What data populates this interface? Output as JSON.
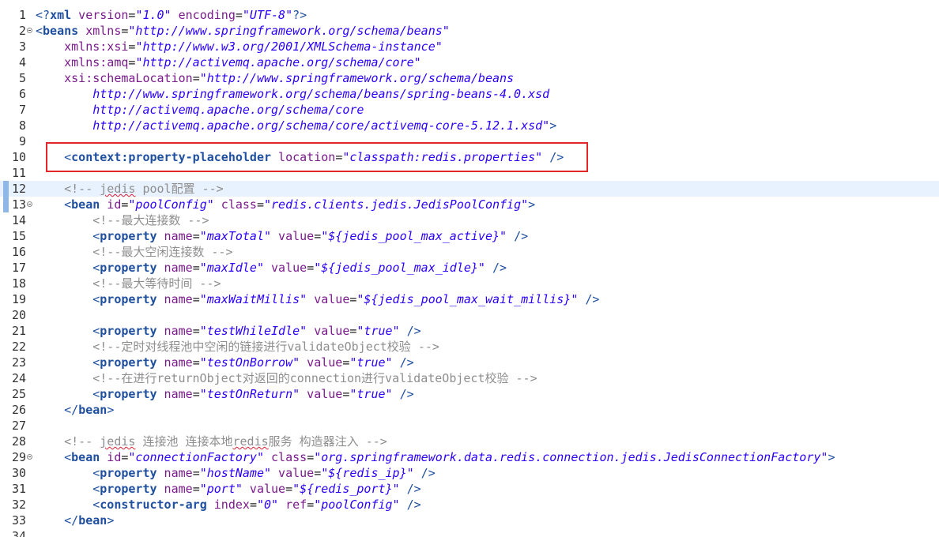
{
  "editor": {
    "lines": [
      {
        "n": "1",
        "segs": [
          {
            "c": "tag",
            "t": "<?"
          },
          {
            "c": "tagn",
            "t": "xml"
          },
          {
            "c": "an",
            "t": " version"
          },
          {
            "c": "pl",
            "t": "="
          },
          {
            "c": "av",
            "t": "\"1.0\""
          },
          {
            "c": "an",
            "t": " encoding"
          },
          {
            "c": "pl",
            "t": "="
          },
          {
            "c": "av",
            "t": "\"UTF-8\""
          },
          {
            "c": "tag",
            "t": "?>"
          }
        ]
      },
      {
        "n": "2",
        "fold": true,
        "segs": [
          {
            "c": "tag",
            "t": "<"
          },
          {
            "c": "tagn",
            "t": "beans"
          },
          {
            "c": "an",
            "t": " xmlns"
          },
          {
            "c": "pl",
            "t": "="
          },
          {
            "c": "av",
            "t": "\"http://www.springframework.org/schema/beans\""
          }
        ]
      },
      {
        "n": "3",
        "segs": [
          {
            "c": "an",
            "t": "    xmlns:xsi"
          },
          {
            "c": "pl",
            "t": "="
          },
          {
            "c": "av",
            "t": "\"http://www.w3.org/2001/XMLSchema-instance\""
          }
        ]
      },
      {
        "n": "4",
        "segs": [
          {
            "c": "an",
            "t": "    xmlns:amq"
          },
          {
            "c": "pl",
            "t": "="
          },
          {
            "c": "av",
            "t": "\"http://activemq.apache.org/schema/core\""
          }
        ]
      },
      {
        "n": "5",
        "segs": [
          {
            "c": "an",
            "t": "    xsi:schemaLocation"
          },
          {
            "c": "pl",
            "t": "="
          },
          {
            "c": "av",
            "t": "\"http://www.springframework.org/schema/beans"
          }
        ]
      },
      {
        "n": "6",
        "segs": [
          {
            "c": "av",
            "t": "        http://www.springframework.org/schema/beans/spring-beans-4.0.xsd"
          }
        ]
      },
      {
        "n": "7",
        "segs": [
          {
            "c": "av",
            "t": "        http://activemq.apache.org/schema/core"
          }
        ]
      },
      {
        "n": "8",
        "segs": [
          {
            "c": "av",
            "t": "        http://activemq.apache.org/schema/core/activemq-core-5.12.1.xsd\""
          },
          {
            "c": "tag",
            "t": ">"
          }
        ]
      },
      {
        "n": "9",
        "segs": []
      },
      {
        "n": "10",
        "segs": [
          {
            "c": "tag",
            "t": "    <"
          },
          {
            "c": "tagn",
            "t": "context:property-placeholder"
          },
          {
            "c": "an",
            "t": " location"
          },
          {
            "c": "pl",
            "t": "="
          },
          {
            "c": "av",
            "t": "\"classpath:redis.properties\""
          },
          {
            "c": "tag",
            "t": " />"
          }
        ]
      },
      {
        "n": "11",
        "segs": []
      },
      {
        "n": "12",
        "marker": true,
        "current": true,
        "segs": [
          {
            "c": "cm",
            "t": "    <!-- "
          },
          {
            "c": "cm squig",
            "t": "jedis"
          },
          {
            "c": "cm",
            "t": " pool配置 -->"
          }
        ]
      },
      {
        "n": "13",
        "fold": true,
        "marker": true,
        "segs": [
          {
            "c": "tag",
            "t": "    <"
          },
          {
            "c": "tagn",
            "t": "bean"
          },
          {
            "c": "an",
            "t": " id"
          },
          {
            "c": "pl",
            "t": "="
          },
          {
            "c": "av",
            "t": "\"poolConfig\""
          },
          {
            "c": "an",
            "t": " class"
          },
          {
            "c": "pl",
            "t": "="
          },
          {
            "c": "av",
            "t": "\"redis.clients.jedis.JedisPoolConfig\""
          },
          {
            "c": "tag",
            "t": ">"
          }
        ]
      },
      {
        "n": "14",
        "segs": [
          {
            "c": "cm",
            "t": "        <!--最大连接数 -->"
          }
        ]
      },
      {
        "n": "15",
        "segs": [
          {
            "c": "tag",
            "t": "        <"
          },
          {
            "c": "tagn",
            "t": "property"
          },
          {
            "c": "an",
            "t": " name"
          },
          {
            "c": "pl",
            "t": "="
          },
          {
            "c": "av",
            "t": "\"maxTotal\""
          },
          {
            "c": "an",
            "t": " value"
          },
          {
            "c": "pl",
            "t": "="
          },
          {
            "c": "av",
            "t": "\"${jedis_pool_max_active}\""
          },
          {
            "c": "tag",
            "t": " />"
          }
        ]
      },
      {
        "n": "16",
        "segs": [
          {
            "c": "cm",
            "t": "        <!--最大空闲连接数 -->"
          }
        ]
      },
      {
        "n": "17",
        "segs": [
          {
            "c": "tag",
            "t": "        <"
          },
          {
            "c": "tagn",
            "t": "property"
          },
          {
            "c": "an",
            "t": " name"
          },
          {
            "c": "pl",
            "t": "="
          },
          {
            "c": "av",
            "t": "\"maxIdle\""
          },
          {
            "c": "an",
            "t": " value"
          },
          {
            "c": "pl",
            "t": "="
          },
          {
            "c": "av",
            "t": "\"${jedis_pool_max_idle}\""
          },
          {
            "c": "tag",
            "t": " />"
          }
        ]
      },
      {
        "n": "18",
        "segs": [
          {
            "c": "cm",
            "t": "        <!--最大等待时间 -->"
          }
        ]
      },
      {
        "n": "19",
        "segs": [
          {
            "c": "tag",
            "t": "        <"
          },
          {
            "c": "tagn",
            "t": "property"
          },
          {
            "c": "an",
            "t": " name"
          },
          {
            "c": "pl",
            "t": "="
          },
          {
            "c": "av",
            "t": "\"maxWaitMillis\""
          },
          {
            "c": "an",
            "t": " value"
          },
          {
            "c": "pl",
            "t": "="
          },
          {
            "c": "av",
            "t": "\"${jedis_pool_max_wait_millis}\""
          },
          {
            "c": "tag",
            "t": " />"
          }
        ]
      },
      {
        "n": "20",
        "segs": []
      },
      {
        "n": "21",
        "segs": [
          {
            "c": "tag",
            "t": "        <"
          },
          {
            "c": "tagn",
            "t": "property"
          },
          {
            "c": "an",
            "t": " name"
          },
          {
            "c": "pl",
            "t": "="
          },
          {
            "c": "av",
            "t": "\"testWhileIdle\""
          },
          {
            "c": "an",
            "t": " value"
          },
          {
            "c": "pl",
            "t": "="
          },
          {
            "c": "av",
            "t": "\"true\""
          },
          {
            "c": "tag",
            "t": " />"
          }
        ]
      },
      {
        "n": "22",
        "segs": [
          {
            "c": "cm",
            "t": "        <!--定时对线程池中空闲的链接进行validateObject校验 -->"
          }
        ]
      },
      {
        "n": "23",
        "segs": [
          {
            "c": "tag",
            "t": "        <"
          },
          {
            "c": "tagn",
            "t": "property"
          },
          {
            "c": "an",
            "t": " name"
          },
          {
            "c": "pl",
            "t": "="
          },
          {
            "c": "av",
            "t": "\"testOnBorrow\""
          },
          {
            "c": "an",
            "t": " value"
          },
          {
            "c": "pl",
            "t": "="
          },
          {
            "c": "av",
            "t": "\"true\""
          },
          {
            "c": "tag",
            "t": " />"
          }
        ]
      },
      {
        "n": "24",
        "segs": [
          {
            "c": "cm",
            "t": "        <!--在进行returnObject对返回的connection进行validateObject校验 -->"
          }
        ]
      },
      {
        "n": "25",
        "segs": [
          {
            "c": "tag",
            "t": "        <"
          },
          {
            "c": "tagn",
            "t": "property"
          },
          {
            "c": "an",
            "t": " name"
          },
          {
            "c": "pl",
            "t": "="
          },
          {
            "c": "av",
            "t": "\"testOnReturn\""
          },
          {
            "c": "an",
            "t": " value"
          },
          {
            "c": "pl",
            "t": "="
          },
          {
            "c": "av",
            "t": "\"true\""
          },
          {
            "c": "tag",
            "t": " />"
          }
        ]
      },
      {
        "n": "26",
        "segs": [
          {
            "c": "tag",
            "t": "    </"
          },
          {
            "c": "tagn",
            "t": "bean"
          },
          {
            "c": "tag",
            "t": ">"
          }
        ]
      },
      {
        "n": "27",
        "segs": []
      },
      {
        "n": "28",
        "segs": [
          {
            "c": "cm",
            "t": "    <!-- "
          },
          {
            "c": "cm squig",
            "t": "jedis"
          },
          {
            "c": "cm",
            "t": " 连接池 连接本地"
          },
          {
            "c": "cm squig",
            "t": "redis"
          },
          {
            "c": "cm",
            "t": "服务 构造器注入 -->"
          }
        ]
      },
      {
        "n": "29",
        "fold": true,
        "segs": [
          {
            "c": "tag",
            "t": "    <"
          },
          {
            "c": "tagn",
            "t": "bean"
          },
          {
            "c": "an",
            "t": " id"
          },
          {
            "c": "pl",
            "t": "="
          },
          {
            "c": "av",
            "t": "\"connectionFactory\""
          },
          {
            "c": "an",
            "t": " class"
          },
          {
            "c": "pl",
            "t": "="
          },
          {
            "c": "av",
            "t": "\"org.springframework.data.redis.connection.jedis.JedisConnectionFactory\""
          },
          {
            "c": "tag",
            "t": ">"
          }
        ]
      },
      {
        "n": "30",
        "segs": [
          {
            "c": "tag",
            "t": "        <"
          },
          {
            "c": "tagn",
            "t": "property"
          },
          {
            "c": "an",
            "t": " name"
          },
          {
            "c": "pl",
            "t": "="
          },
          {
            "c": "av",
            "t": "\"hostName\""
          },
          {
            "c": "an",
            "t": " value"
          },
          {
            "c": "pl",
            "t": "="
          },
          {
            "c": "av",
            "t": "\"${redis_ip}\""
          },
          {
            "c": "tag",
            "t": " />"
          }
        ]
      },
      {
        "n": "31",
        "segs": [
          {
            "c": "tag",
            "t": "        <"
          },
          {
            "c": "tagn",
            "t": "property"
          },
          {
            "c": "an",
            "t": " name"
          },
          {
            "c": "pl",
            "t": "="
          },
          {
            "c": "av",
            "t": "\"port\""
          },
          {
            "c": "an",
            "t": " value"
          },
          {
            "c": "pl",
            "t": "="
          },
          {
            "c": "av",
            "t": "\"${redis_port}\""
          },
          {
            "c": "tag",
            "t": " />"
          }
        ]
      },
      {
        "n": "32",
        "segs": [
          {
            "c": "tag",
            "t": "        <"
          },
          {
            "c": "tagn",
            "t": "constructor-arg"
          },
          {
            "c": "an",
            "t": " index"
          },
          {
            "c": "pl",
            "t": "="
          },
          {
            "c": "av",
            "t": "\"0\""
          },
          {
            "c": "an",
            "t": " ref"
          },
          {
            "c": "pl",
            "t": "="
          },
          {
            "c": "av",
            "t": "\"poolConfig\""
          },
          {
            "c": "tag",
            "t": " />"
          }
        ]
      },
      {
        "n": "33",
        "segs": [
          {
            "c": "tag",
            "t": "    </"
          },
          {
            "c": "tagn",
            "t": "bean"
          },
          {
            "c": "tag",
            "t": ">"
          }
        ]
      },
      {
        "n": "34",
        "segs": []
      }
    ],
    "highlight_line": "10",
    "highlight_color": "#e2262a"
  }
}
